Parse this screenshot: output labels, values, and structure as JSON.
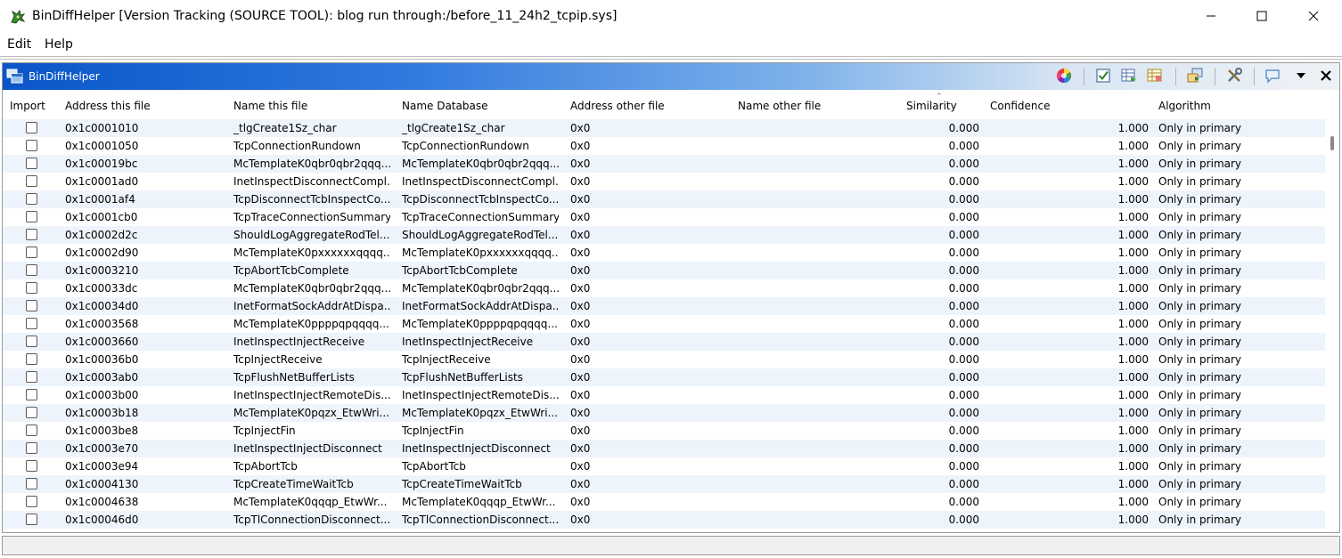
{
  "window": {
    "title": "BinDiffHelper [Version Tracking (SOURCE TOOL): blog run through:/before_11_24h2_tcpip.sys]",
    "app_icon": "dragon-icon",
    "controls": [
      "minimize-icon",
      "maximize-icon",
      "close-icon"
    ]
  },
  "menu": {
    "edit": "Edit",
    "help": "Help"
  },
  "panel": {
    "title": "BinDiffHelper",
    "header_gradient": [
      "#0a55c8",
      "#eef2f6"
    ],
    "toolbar_icons": [
      "color-wheel-icon",
      "check-all-icon",
      "table-export-icon",
      "table-config-icon",
      "import-functions-icon",
      "tools-icon",
      "comment-icon",
      "menu-dropdown-icon",
      "close-panel-icon"
    ]
  },
  "table": {
    "columns": {
      "import": "Import",
      "address_this": "Address this file",
      "name_this": "Name this file",
      "name_db": "Name Database",
      "address_other": "Address other file",
      "name_other": "Name other file",
      "similarity": "Similarity",
      "confidence": "Confidence",
      "algorithm": "Algorithm"
    },
    "sorted_by": "Similarity",
    "row_alt_color": "#eef4fb",
    "rows": [
      {
        "addr": "0x1c0001010",
        "name": "_tlgCreate1Sz_char",
        "dbname": "_tlgCreate1Sz_char",
        "other": "0x0",
        "other_name": "",
        "sim": "0.000",
        "conf": "1.000",
        "algo": "Only in primary",
        "checked": false
      },
      {
        "addr": "0x1c0001050",
        "name": "TcpConnectionRundown",
        "dbname": "TcpConnectionRundown",
        "other": "0x0",
        "other_name": "",
        "sim": "0.000",
        "conf": "1.000",
        "algo": "Only in primary",
        "checked": false
      },
      {
        "addr": "0x1c00019bc",
        "name": "McTemplateK0qbr0qbr2qqq...",
        "dbname": "McTemplateK0qbr0qbr2qqq...",
        "other": "0x0",
        "other_name": "",
        "sim": "0.000",
        "conf": "1.000",
        "algo": "Only in primary",
        "checked": false
      },
      {
        "addr": "0x1c0001ad0",
        "name": "InetInspectDisconnectCompl...",
        "dbname": "InetInspectDisconnectCompl...",
        "other": "0x0",
        "other_name": "",
        "sim": "0.000",
        "conf": "1.000",
        "algo": "Only in primary",
        "checked": false
      },
      {
        "addr": "0x1c0001af4",
        "name": "TcpDisconnectTcbInspectCo...",
        "dbname": "TcpDisconnectTcbInspectCo...",
        "other": "0x0",
        "other_name": "",
        "sim": "0.000",
        "conf": "1.000",
        "algo": "Only in primary",
        "checked": false
      },
      {
        "addr": "0x1c0001cb0",
        "name": "TcpTraceConnectionSummary",
        "dbname": "TcpTraceConnectionSummary",
        "other": "0x0",
        "other_name": "",
        "sim": "0.000",
        "conf": "1.000",
        "algo": "Only in primary",
        "checked": false
      },
      {
        "addr": "0x1c0002d2c",
        "name": "ShouldLogAggregateRodTel...",
        "dbname": "ShouldLogAggregateRodTel...",
        "other": "0x0",
        "other_name": "",
        "sim": "0.000",
        "conf": "1.000",
        "algo": "Only in primary",
        "checked": false
      },
      {
        "addr": "0x1c0002d90",
        "name": "McTemplateK0pxxxxxxqqqq...",
        "dbname": "McTemplateK0pxxxxxxqqqq...",
        "other": "0x0",
        "other_name": "",
        "sim": "0.000",
        "conf": "1.000",
        "algo": "Only in primary",
        "checked": false
      },
      {
        "addr": "0x1c0003210",
        "name": "TcpAbortTcbComplete",
        "dbname": "TcpAbortTcbComplete",
        "other": "0x0",
        "other_name": "",
        "sim": "0.000",
        "conf": "1.000",
        "algo": "Only in primary",
        "checked": false
      },
      {
        "addr": "0x1c00033dc",
        "name": "McTemplateK0qbr0qbr2qqq...",
        "dbname": "McTemplateK0qbr0qbr2qqq...",
        "other": "0x0",
        "other_name": "",
        "sim": "0.000",
        "conf": "1.000",
        "algo": "Only in primary",
        "checked": false
      },
      {
        "addr": "0x1c00034d0",
        "name": "InetFormatSockAddrAtDispa...",
        "dbname": "InetFormatSockAddrAtDispa...",
        "other": "0x0",
        "other_name": "",
        "sim": "0.000",
        "conf": "1.000",
        "algo": "Only in primary",
        "checked": false
      },
      {
        "addr": "0x1c0003568",
        "name": "McTemplateK0ppppqpqqqq...",
        "dbname": "McTemplateK0ppppqpqqqq...",
        "other": "0x0",
        "other_name": "",
        "sim": "0.000",
        "conf": "1.000",
        "algo": "Only in primary",
        "checked": false
      },
      {
        "addr": "0x1c0003660",
        "name": "InetInspectInjectReceive",
        "dbname": "InetInspectInjectReceive",
        "other": "0x0",
        "other_name": "",
        "sim": "0.000",
        "conf": "1.000",
        "algo": "Only in primary",
        "checked": false
      },
      {
        "addr": "0x1c00036b0",
        "name": "TcpInjectReceive",
        "dbname": "TcpInjectReceive",
        "other": "0x0",
        "other_name": "",
        "sim": "0.000",
        "conf": "1.000",
        "algo": "Only in primary",
        "checked": false
      },
      {
        "addr": "0x1c0003ab0",
        "name": "TcpFlushNetBufferLists",
        "dbname": "TcpFlushNetBufferLists",
        "other": "0x0",
        "other_name": "",
        "sim": "0.000",
        "conf": "1.000",
        "algo": "Only in primary",
        "checked": false
      },
      {
        "addr": "0x1c0003b00",
        "name": "InetInspectInjectRemoteDis...",
        "dbname": "InetInspectInjectRemoteDis...",
        "other": "0x0",
        "other_name": "",
        "sim": "0.000",
        "conf": "1.000",
        "algo": "Only in primary",
        "checked": false
      },
      {
        "addr": "0x1c0003b18",
        "name": "McTemplateK0pqzx_EtwWri...",
        "dbname": "McTemplateK0pqzx_EtwWri...",
        "other": "0x0",
        "other_name": "",
        "sim": "0.000",
        "conf": "1.000",
        "algo": "Only in primary",
        "checked": false
      },
      {
        "addr": "0x1c0003be8",
        "name": "TcpInjectFin",
        "dbname": "TcpInjectFin",
        "other": "0x0",
        "other_name": "",
        "sim": "0.000",
        "conf": "1.000",
        "algo": "Only in primary",
        "checked": false
      },
      {
        "addr": "0x1c0003e70",
        "name": "InetInspectInjectDisconnect",
        "dbname": "InetInspectInjectDisconnect",
        "other": "0x0",
        "other_name": "",
        "sim": "0.000",
        "conf": "1.000",
        "algo": "Only in primary",
        "checked": false
      },
      {
        "addr": "0x1c0003e94",
        "name": "TcpAbortTcb",
        "dbname": "TcpAbortTcb",
        "other": "0x0",
        "other_name": "",
        "sim": "0.000",
        "conf": "1.000",
        "algo": "Only in primary",
        "checked": false
      },
      {
        "addr": "0x1c0004130",
        "name": "TcpCreateTimeWaitTcb",
        "dbname": "TcpCreateTimeWaitTcb",
        "other": "0x0",
        "other_name": "",
        "sim": "0.000",
        "conf": "1.000",
        "algo": "Only in primary",
        "checked": false
      },
      {
        "addr": "0x1c0004638",
        "name": "McTemplateK0qqqp_EtwWr...",
        "dbname": "McTemplateK0qqqp_EtwWr...",
        "other": "0x0",
        "other_name": "",
        "sim": "0.000",
        "conf": "1.000",
        "algo": "Only in primary",
        "checked": false
      },
      {
        "addr": "0x1c00046d0",
        "name": "TcpTlConnectionDisconnect...",
        "dbname": "TcpTlConnectionDisconnect...",
        "other": "0x0",
        "other_name": "",
        "sim": "0.000",
        "conf": "1.000",
        "algo": "Only in primary",
        "checked": false
      }
    ]
  },
  "status": {
    "text": ""
  }
}
